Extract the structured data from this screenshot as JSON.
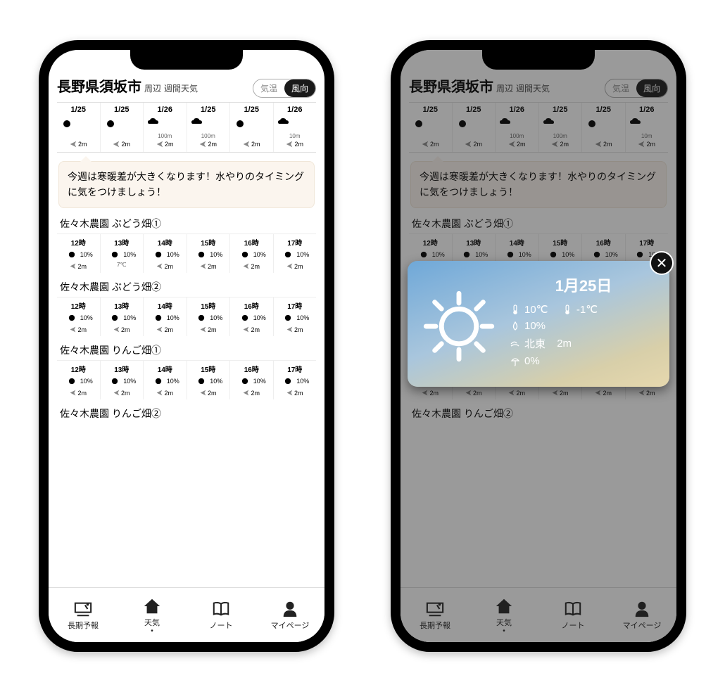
{
  "header": {
    "location": "長野県須坂市",
    "suffix1": "周辺",
    "suffix2": "週間天気",
    "toggle_temp": "気温",
    "toggle_wind": "風向"
  },
  "week": [
    {
      "date": "1/25",
      "icon": "sun",
      "dist": "",
      "wind": "2m"
    },
    {
      "date": "1/25",
      "icon": "sun",
      "dist": "",
      "wind": "2m"
    },
    {
      "date": "1/26",
      "icon": "rain",
      "dist": "100m",
      "wind": "2m"
    },
    {
      "date": "1/25",
      "icon": "rain-light",
      "dist": "100m",
      "wind": "2m"
    },
    {
      "date": "1/25",
      "icon": "sun",
      "dist": "",
      "wind": "2m"
    },
    {
      "date": "1/26",
      "icon": "rain",
      "dist": "10m",
      "wind": "2m"
    }
  ],
  "tip": "今週は寒暖差が大きくなります！水やりのタイミングに気をつけましょう！",
  "farms": [
    {
      "title": "佐々木農園 ぶどう畑①",
      "hours": [
        {
          "time": "12時",
          "pct": "10%",
          "wind": "2m",
          "extra": ""
        },
        {
          "time": "13時",
          "pct": "10%",
          "wind": "",
          "extra": "7℃"
        },
        {
          "time": "14時",
          "pct": "10%",
          "wind": "2m",
          "extra": ""
        },
        {
          "time": "15時",
          "pct": "10%",
          "wind": "2m",
          "extra": ""
        },
        {
          "time": "16時",
          "pct": "10%",
          "wind": "2m",
          "extra": ""
        },
        {
          "time": "17時",
          "pct": "10%",
          "wind": "2m",
          "extra": ""
        }
      ]
    },
    {
      "title": "佐々木農園 ぶどう畑②",
      "hours": [
        {
          "time": "12時",
          "pct": "10%",
          "wind": "2m",
          "extra": ""
        },
        {
          "time": "13時",
          "pct": "10%",
          "wind": "2m",
          "extra": ""
        },
        {
          "time": "14時",
          "pct": "10%",
          "wind": "2m",
          "extra": ""
        },
        {
          "time": "15時",
          "pct": "10%",
          "wind": "2m",
          "extra": ""
        },
        {
          "time": "16時",
          "pct": "10%",
          "wind": "2m",
          "extra": ""
        },
        {
          "time": "17時",
          "pct": "10%",
          "wind": "2m",
          "extra": ""
        }
      ]
    },
    {
      "title": "佐々木農園 りんご畑①",
      "hours": [
        {
          "time": "12時",
          "pct": "10%",
          "wind": "2m",
          "extra": ""
        },
        {
          "time": "13時",
          "pct": "10%",
          "wind": "2m",
          "extra": ""
        },
        {
          "time": "14時",
          "pct": "10%",
          "wind": "2m",
          "extra": ""
        },
        {
          "time": "15時",
          "pct": "10%",
          "wind": "2m",
          "extra": ""
        },
        {
          "time": "16時",
          "pct": "10%",
          "wind": "2m",
          "extra": ""
        },
        {
          "time": "17時",
          "pct": "10%",
          "wind": "2m",
          "extra": ""
        }
      ]
    },
    {
      "title": "佐々木農園 りんご畑②",
      "hours": []
    }
  ],
  "tabs": {
    "forecast": "長期予報",
    "weather": "天気",
    "note": "ノート",
    "mypage": "マイページ"
  },
  "detail": {
    "date": "1月25日",
    "temp_high": "10℃",
    "temp_low": "-1℃",
    "humidity": "10%",
    "wind_dir": "北東",
    "wind_speed": "2m",
    "rain": "0%"
  }
}
